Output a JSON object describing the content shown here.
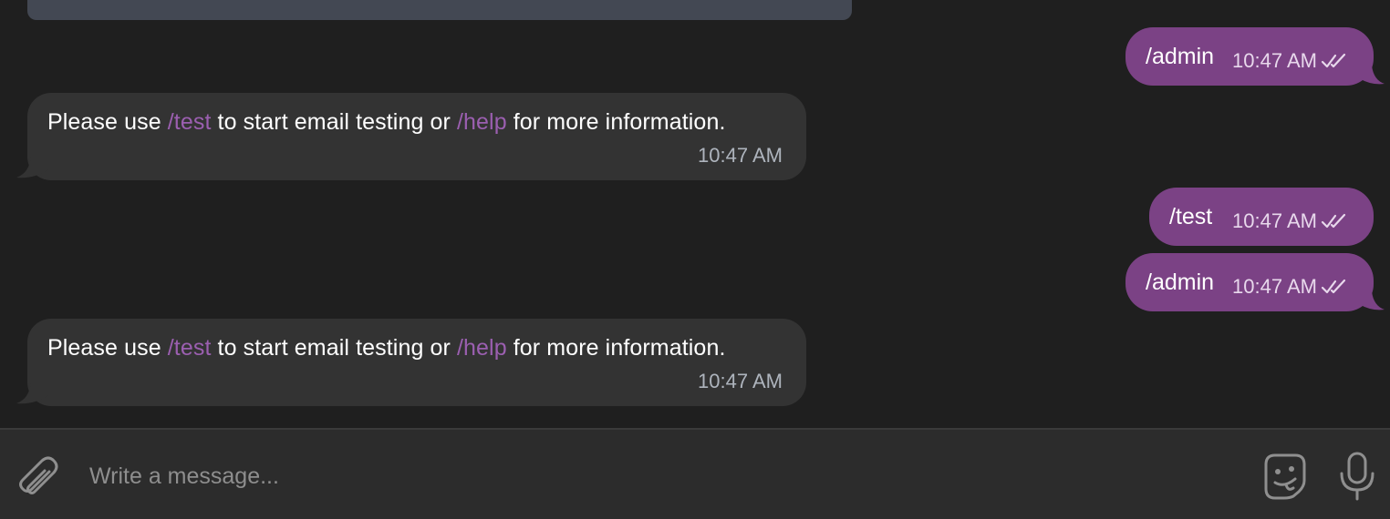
{
  "messages": [
    {
      "direction": "outgoing",
      "text": "/admin",
      "time": "10:47 AM"
    },
    {
      "direction": "incoming",
      "prefix": "Please use ",
      "cmd1": "/test",
      "middle": " to start email testing or ",
      "cmd2": "/help",
      "suffix": " for more information.",
      "time": "10:47 AM"
    },
    {
      "direction": "outgoing",
      "text": "/test",
      "time": "10:47 AM"
    },
    {
      "direction": "outgoing",
      "text": "/admin",
      "time": "10:47 AM"
    },
    {
      "direction": "incoming",
      "prefix": "Please use ",
      "cmd1": "/test",
      "middle": " to start email testing or ",
      "cmd2": "/help",
      "suffix": " for more information.",
      "time": "10:47 AM"
    }
  ],
  "composer": {
    "placeholder": "Write a message...",
    "attach_icon": "paperclip-icon",
    "sticker_icon": "sticker-icon",
    "mic_icon": "microphone-icon"
  },
  "colors": {
    "outgoing_bubble": "#7b4285",
    "incoming_bubble": "#333333",
    "command_link": "#9b5fb0",
    "background": "#1f1f1f"
  }
}
